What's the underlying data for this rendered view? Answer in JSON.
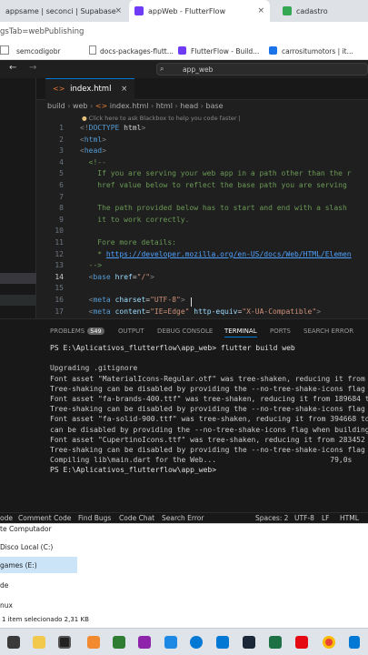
{
  "browser": {
    "tabs": [
      {
        "label": "appsame | seconci | Supabase",
        "close": "×"
      },
      {
        "label": "appWeb - FlutterFlow",
        "close": "×"
      },
      {
        "label": "cadastro"
      }
    ],
    "address": "gsTab=webPublishing",
    "bookmarks": [
      "semcodigobr",
      "docs-packages-flutt...",
      "FlutterFlow - Build...",
      "carrositumotors | it..."
    ]
  },
  "vscode": {
    "command_center": "app_web",
    "editor_tab": {
      "label": "index.html",
      "close": "×"
    },
    "breadcrumb": {
      "b1": "build",
      "b2": "web",
      "b3": "index.html",
      "b4": "html",
      "b5": "head",
      "b6": "base"
    },
    "hint": "Click here to ask Blackbox to help you code faster |",
    "lines": [
      {
        "n": "1",
        "t": "<!DOCTYPE html>"
      },
      {
        "n": "2",
        "t": "<html>"
      },
      {
        "n": "3",
        "t": "<head>"
      },
      {
        "n": "4",
        "t": "  <!--"
      },
      {
        "n": "5",
        "t": "    If you are serving your web app in a path other than the r"
      },
      {
        "n": "6",
        "t": "    href value below to reflect the base path you are serving"
      },
      {
        "n": "7",
        "t": ""
      },
      {
        "n": "8",
        "t": "    The path provided below has to start and end with a slash"
      },
      {
        "n": "9",
        "t": "    it to work correctly."
      },
      {
        "n": "10",
        "t": ""
      },
      {
        "n": "11",
        "t": "    Fore more details:"
      },
      {
        "n": "12",
        "t": "    * https://developer.mozilla.org/en-US/docs/Web/HTML/Elemen"
      },
      {
        "n": "13",
        "t": "  -->"
      },
      {
        "n": "14",
        "t": "  <base href=\"/\">"
      },
      {
        "n": "15",
        "t": ""
      },
      {
        "n": "16",
        "t": "  <meta charset=\"UTF-8\">"
      },
      {
        "n": "17",
        "t": "  <meta content=\"IE=Edge\" http-equiv=\"X-UA-Compatible\">"
      }
    ],
    "panel_tabs": {
      "problems": "PROBLEMS",
      "problems_count": "549",
      "output": "OUTPUT",
      "debug": "DEBUG CONSOLE",
      "terminal": "TERMINAL",
      "ports": "PORTS",
      "search_error": "SEARCH ERROR"
    },
    "terminal": [
      "PS E:\\Aplicativos_flutterflow\\app_web> flutter build web",
      "",
      "Upgrading .gitignore",
      "Font asset \"MaterialIcons-Regular.otf\" was tree-shaken, reducing it from 16",
      "Tree-shaking can be disabled by providing the --no-tree-shake-icons flag wh",
      "Font asset \"fa-brands-400.ttf\" was tree-shaken, reducing it from 189684 to",
      "Tree-shaking can be disabled by providing the --no-tree-shake-icons flag wh",
      "Font asset \"fa-solid-900.ttf\" was tree-shaken, reducing it from 394668 to 1",
      "can be disabled by providing the --no-tree-shake-icons flag when building y",
      "Font asset \"CupertinoIcons.ttf\" was tree-shaken, reducing it from 283452 to",
      "Tree-shaking can be disabled by providing the --no-tree-shake-icons flag wh",
      "Compiling lib\\main.dart for the Web...                          79,0s",
      "PS E:\\Aplicativos_flutterflow\\app_web> "
    ],
    "status": {
      "s1": "ode",
      "s2": "Comment Code",
      "s3": "Find Bugs",
      "s4": "Code Chat",
      "s5": "Search Error",
      "s6": "Spaces: 2",
      "s7": "UTF-8",
      "s8": "LF",
      "s9": "HTML"
    }
  },
  "file_explorer": {
    "items": [
      "te Computador",
      "Disco Local (C:)",
      "games (E:)",
      "de",
      "nux"
    ],
    "status": "1 item selecionado  2,31 KB"
  },
  "colors": {
    "keyword": "#569cd6",
    "attr": "#9cdcfe",
    "string": "#ce9178",
    "comment": "#6a9955",
    "link": "#4ea1ff"
  }
}
